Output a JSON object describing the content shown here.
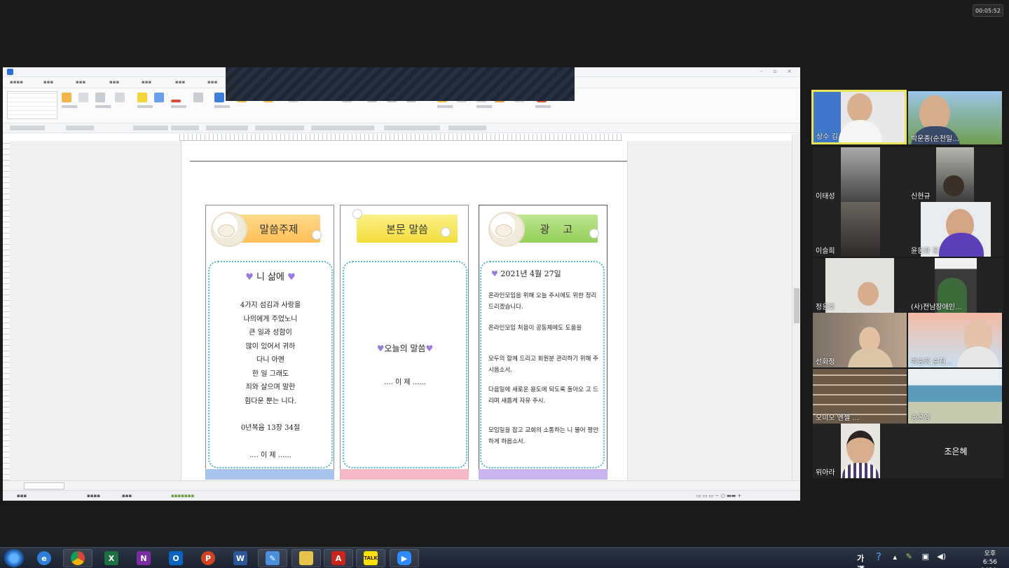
{
  "meeting": {
    "timer": "00:05:52"
  },
  "document": {
    "col1": {
      "header": "말씀주제",
      "subtitle": "니 삶에",
      "lines": [
        "4가지 섬김과 사랑을",
        "나의에게 주었노니",
        "큰 일과 성함이",
        "많이 있어서 귀하",
        "다니 아멘",
        "한 일 그래도",
        "죄와 살으며 말한",
        "힘다운 뿐는 니다.",
        "",
        "0년복음 13장 34절"
      ],
      "footer": ".... 이 제 ......"
    },
    "col2": {
      "header": "본문 말씀",
      "title": "오늘의 말씀",
      "footer": ".... 이 제 ......"
    },
    "col3": {
      "header": "광    고",
      "title": "2021년 4월 27일",
      "items": [
        "온라인모임을 위해 오늘 주시에도 위한 정리드리겠습니다.",
        "온라인모임 처음이 공동체에도 도움을",
        "모두의 함께 드리고 회원분 관리하기 위해 주시옵소서.",
        "다음일에 새로운 용도에 되도록 돌아오 고 드리며 새롭게 자유 주시.",
        "모임일을 잡고 교회의 소통하는 니 물어 평안하게 하옵소서."
      ]
    }
  },
  "participants": [
    {
      "name": "상수 김",
      "active": true
    },
    {
      "name": "박운종(순천밀..."
    },
    {
      "name": "이태성"
    },
    {
      "name": "신현규"
    },
    {
      "name": "이슬희"
    },
    {
      "name": "윤동환 윤"
    },
    {
      "name": "정윤호"
    },
    {
      "name": "(사)전남장애인..."
    },
    {
      "name": "선화정"
    },
    {
      "name": "박송희 순천..."
    },
    {
      "name": "오미오 엔젤 ..."
    },
    {
      "name": "송은영"
    },
    {
      "name": "위아라"
    },
    {
      "name": "조은혜"
    }
  ],
  "taskbar": {
    "ime": "가 漢",
    "clock_time": "오후 6:56",
    "clock_date": "2021-04-27",
    "apps": [
      "Internet Explorer",
      "Chrome",
      "Excel",
      "OneNote",
      "Outlook",
      "PowerPoint",
      "Word",
      "Hangul",
      "File Explorer",
      "Acrobat",
      "KakaoTalk",
      "Zoom"
    ]
  },
  "colors": {
    "accent_active": "#e9e35a",
    "orange": "#ffc85a",
    "yellow": "#f7e651",
    "green": "#a6d96a",
    "dotted": "#4fb7d8"
  }
}
